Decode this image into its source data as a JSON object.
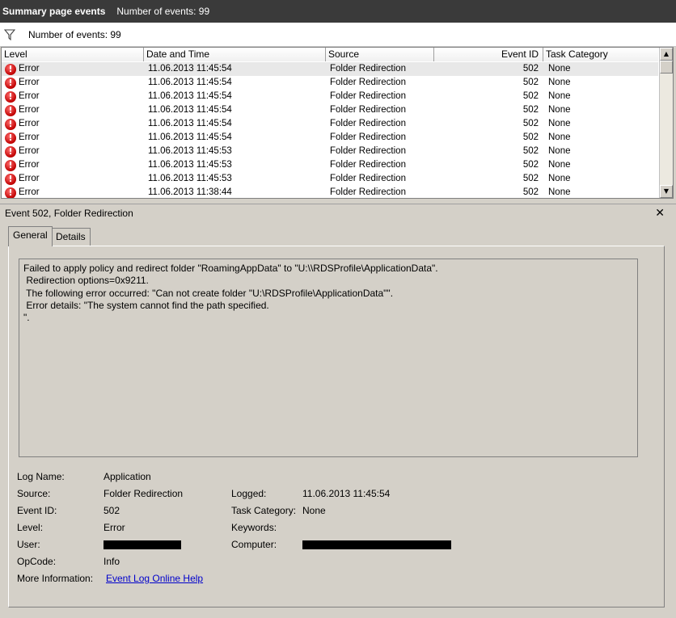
{
  "titlebar": {
    "title": "Summary page events",
    "count": "Number of events: 99"
  },
  "filter": {
    "count": "Number of events: 99",
    "icon": "funnel-icon"
  },
  "columns": {
    "level": "Level",
    "date": "Date and Time",
    "source": "Source",
    "event_id": "Event ID",
    "category": "Task Category"
  },
  "rows": [
    {
      "level": "Error",
      "date": "11.06.2013 11:45:54",
      "source": "Folder Redirection",
      "event_id": "502",
      "category": "None"
    },
    {
      "level": "Error",
      "date": "11.06.2013 11:45:54",
      "source": "Folder Redirection",
      "event_id": "502",
      "category": "None"
    },
    {
      "level": "Error",
      "date": "11.06.2013 11:45:54",
      "source": "Folder Redirection",
      "event_id": "502",
      "category": "None"
    },
    {
      "level": "Error",
      "date": "11.06.2013 11:45:54",
      "source": "Folder Redirection",
      "event_id": "502",
      "category": "None"
    },
    {
      "level": "Error",
      "date": "11.06.2013 11:45:54",
      "source": "Folder Redirection",
      "event_id": "502",
      "category": "None"
    },
    {
      "level": "Error",
      "date": "11.06.2013 11:45:54",
      "source": "Folder Redirection",
      "event_id": "502",
      "category": "None"
    },
    {
      "level": "Error",
      "date": "11.06.2013 11:45:53",
      "source": "Folder Redirection",
      "event_id": "502",
      "category": "None"
    },
    {
      "level": "Error",
      "date": "11.06.2013 11:45:53",
      "source": "Folder Redirection",
      "event_id": "502",
      "category": "None"
    },
    {
      "level": "Error",
      "date": "11.06.2013 11:45:53",
      "source": "Folder Redirection",
      "event_id": "502",
      "category": "None"
    },
    {
      "level": "Error",
      "date": "11.06.2013 11:38:44",
      "source": "Folder Redirection",
      "event_id": "502",
      "category": "None"
    }
  ],
  "detail": {
    "title": "Event 502, Folder Redirection",
    "tabs": {
      "general": "General",
      "details": "Details"
    },
    "message": "Failed to apply policy and redirect folder \"RoamingAppData\" to \"U:\\\\RDSProfile\\ApplicationData\".\n Redirection options=0x9211.\n The following error occurred: \"Can not create folder \"U:\\RDSProfile\\ApplicationData\"\".\n Error details: \"The system cannot find the path specified.\n\".",
    "labels": {
      "log_name": "Log Name:",
      "source": "Source:",
      "event_id": "Event ID:",
      "level": "Level:",
      "user": "User:",
      "opcode": "OpCode:",
      "more_info": "More Information:",
      "logged": "Logged:",
      "task_category": "Task Category:",
      "keywords": "Keywords:",
      "computer": "Computer:"
    },
    "values": {
      "log_name": "Application",
      "source": "Folder Redirection",
      "event_id": "502",
      "level": "Error",
      "opcode": "Info",
      "more_info_link": "Event Log Online Help",
      "logged": "11.06.2013 11:45:54",
      "task_category": "None"
    }
  }
}
